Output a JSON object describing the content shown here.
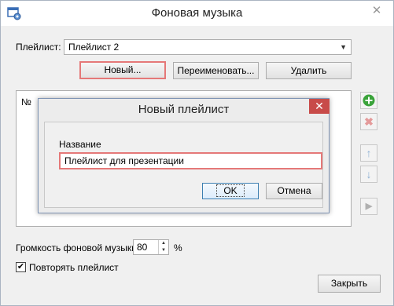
{
  "window": {
    "title": "Фоновая музыка",
    "close_glyph": "✕"
  },
  "playlist": {
    "label": "Плейлист:",
    "selected": "Плейлист 2",
    "new_button": "Новый...",
    "rename_button": "Переименовать...",
    "delete_button": "Удалить"
  },
  "list": {
    "column_no": "№"
  },
  "side_buttons": {
    "add_icon": "+",
    "remove_icon": "✖",
    "up_icon": "↑",
    "down_icon": "↓",
    "play_icon": "▶"
  },
  "volume": {
    "label": "Громкость фоновой музыки:",
    "value": "80",
    "unit": "%"
  },
  "repeat": {
    "label": "Повторять плейлист",
    "checked": true,
    "check_glyph": "✔"
  },
  "close_button": "Закрыть",
  "dialog": {
    "title": "Новый плейлист",
    "close_glyph": "✕",
    "name_label": "Название",
    "name_value": "Плейлист для презентации",
    "ok_button": "OK",
    "cancel_button": "Отмена"
  },
  "colors": {
    "highlight_border": "#e57878",
    "dialog_close_bg": "#c84b49",
    "add_icon": "#3aa33a",
    "remove_icon": "#e49a9a",
    "arrow_icon": "#8fb0d4"
  }
}
